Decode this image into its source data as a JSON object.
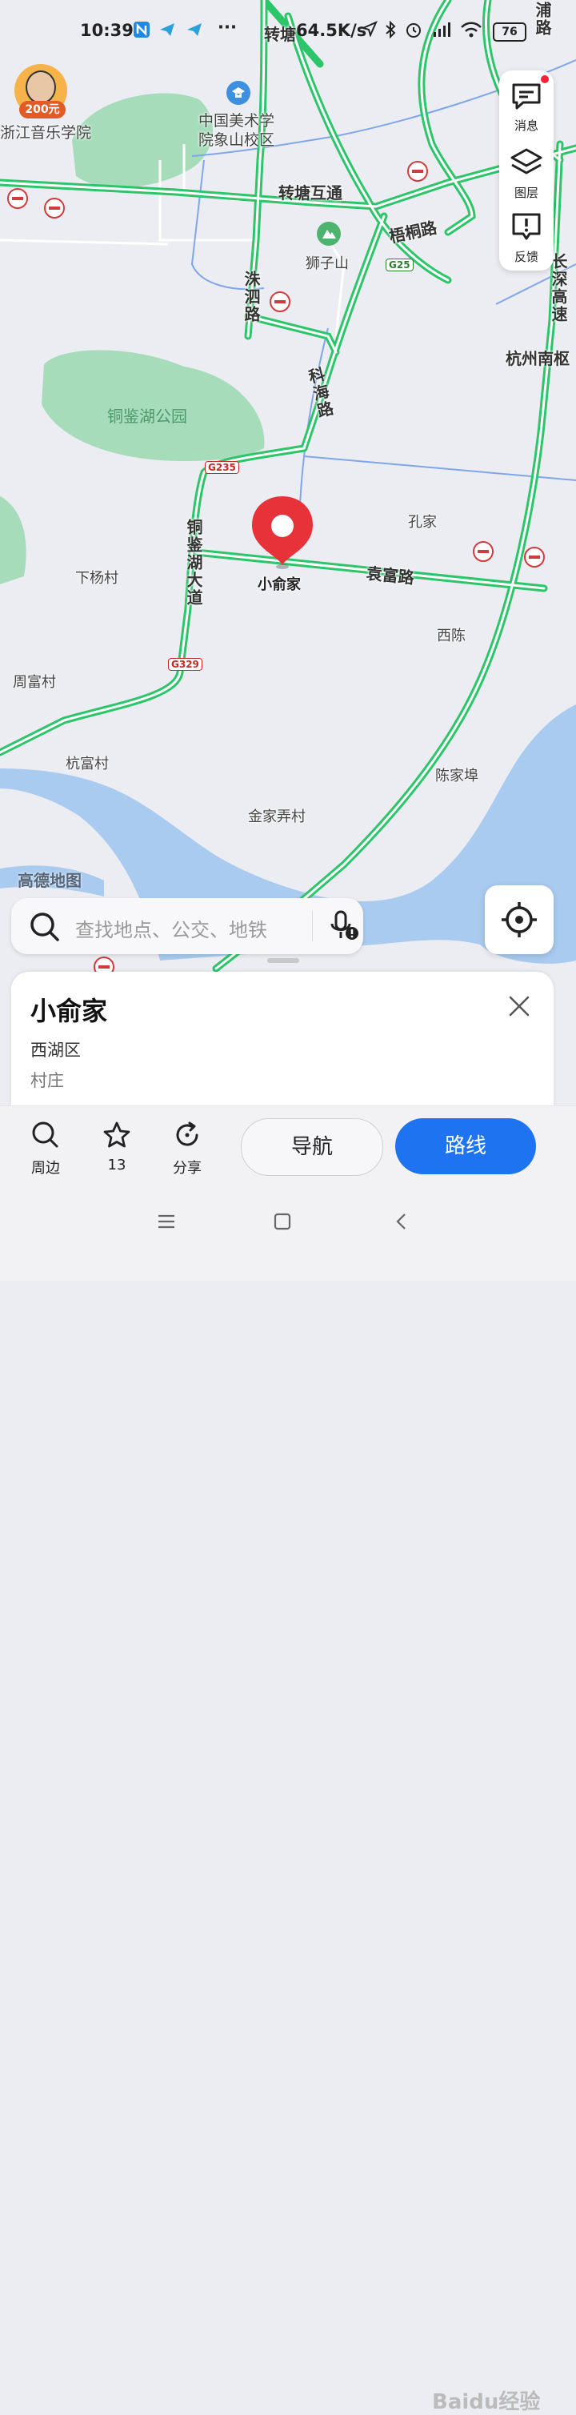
{
  "status_bar": {
    "time": "10:39",
    "speed": "64.5K/s",
    "more": "···",
    "battery": "76"
  },
  "promo": {
    "badge": "200元"
  },
  "map": {
    "labels": {
      "school_cn": "中国美术学",
      "school_cn2": "院象山校区",
      "school_music": "浙江音乐学院",
      "zhuantang_interchange": "转塘互通",
      "zhuantang_top": "转塘",
      "wutong_road": "梧桐路",
      "shizi_mountain": "狮子山",
      "zhusi_road": "洙泗路",
      "kehai_road": "科海路",
      "tongjian_park": "铜鉴湖公园",
      "tongjian_avenue": "铜鉴湖大道",
      "yuanfu_road": "袁富路",
      "kongjia": "孔家",
      "xiyang_village": "下杨村",
      "xichen": "西陈",
      "zhoufu_village": "周富村",
      "hangfu_village": "杭富村",
      "chenjiabu": "陈家埠",
      "jinjianong_village": "金家弄村",
      "hangzhou_south": "杭州南枢",
      "changshen_high": "长深高速",
      "pu_road": "浦路",
      "pin_name": "小俞家",
      "brand": "高德地图"
    },
    "shields": {
      "g235": "G235",
      "g329": "G329",
      "g25": "G25"
    }
  },
  "right_panel": {
    "messages": "消息",
    "layers": "图层",
    "feedback": "反馈"
  },
  "search": {
    "placeholder": "查找地点、公交、地铁"
  },
  "place_card": {
    "name": "小俞家",
    "district": "西湖区",
    "category": "村庄"
  },
  "actions": {
    "nearby": "周边",
    "favorites_count": "13",
    "share": "分享",
    "navigate": "导航",
    "route": "路线"
  },
  "watermark": "Baidu经验",
  "colors": {
    "road_green": "#2DC56A",
    "pin_red": "#E8323A",
    "route_blue": "#1E74F0",
    "water": "#A9CBEF",
    "park": "#9BD8B2"
  }
}
